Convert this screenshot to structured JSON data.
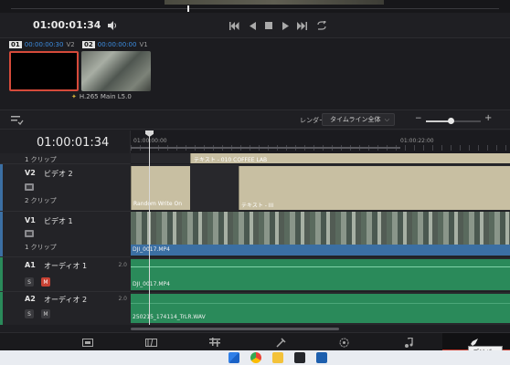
{
  "viewer": {
    "timecode": "01:00:01:34"
  },
  "transport": {
    "buttons": [
      "skip-to-start",
      "previous-frame",
      "stop",
      "play",
      "skip-to-end",
      "loop"
    ]
  },
  "clip_bin": {
    "clips": [
      {
        "index": "01",
        "timecode": "00:00:00:30",
        "track": "V2"
      },
      {
        "index": "02",
        "timecode": "00:00:00:00",
        "track": "V1"
      }
    ],
    "codec": "H.265 Main L5.0"
  },
  "toolbar": {
    "render_label": "レンダー",
    "render_value": "タイムライン全体",
    "zoom_level": 0.45
  },
  "timeline": {
    "timecode": "01:00:01:34",
    "ruler_labels": [
      "01:00:00:00",
      "01:00:22:00"
    ],
    "tracks": [
      {
        "id": "",
        "name": "",
        "clips_text": "1 クリップ"
      },
      {
        "id": "V2",
        "name": "ビデオ 2",
        "clips_text": "2 クリップ"
      },
      {
        "id": "V1",
        "name": "ビデオ 1",
        "clips_text": "1 クリップ"
      },
      {
        "id": "A1",
        "name": "オーディオ 1",
        "volume": "2.0",
        "solo": "S",
        "mute": "M"
      },
      {
        "id": "A2",
        "name": "オーディオ 2",
        "volume": "2.0",
        "solo": "S",
        "mute": "M"
      }
    ],
    "clip_labels": {
      "text_top": "テキスト - 010 COFFEE LAB",
      "random_write": "Random Write On",
      "text_iii": "テキスト - III",
      "video": "DJI_0017.MP4",
      "audio1": "DJI_0017.MP4",
      "audio2": "250215_174114_TrLR.WAV"
    }
  },
  "page_nav": {
    "pages": [
      "media",
      "cut",
      "edit",
      "fusion",
      "color",
      "fairlight",
      "deliver"
    ],
    "active": "deliver",
    "tooltip": "デリバー"
  },
  "colors": {
    "accent_red": "#c63b2e",
    "timecode_blue": "#3d8de0",
    "video_clip": "#3b6fa3",
    "audio_clip": "#2a8a5a",
    "title_clip": "#c8bfa2"
  }
}
